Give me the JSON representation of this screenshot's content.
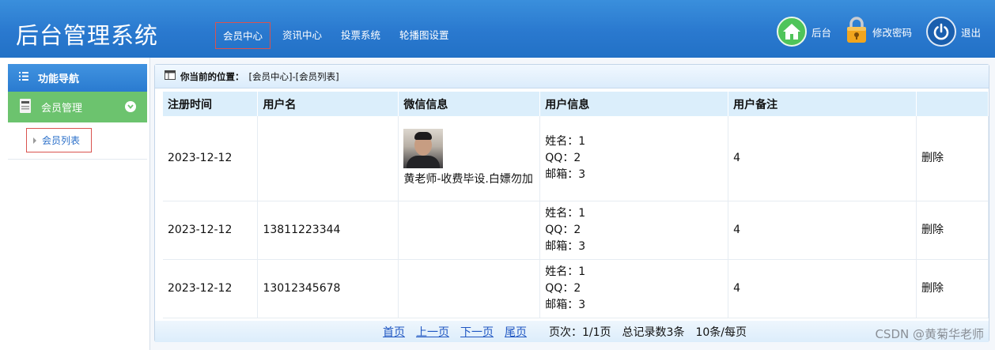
{
  "header": {
    "title": "后台管理系统",
    "nav": [
      {
        "label": "会员中心"
      },
      {
        "label": "资讯中心"
      },
      {
        "label": "投票系统"
      },
      {
        "label": "轮播图设置"
      }
    ],
    "tools": {
      "home_label": "后台",
      "password_label": "修改密码",
      "logout_label": "退出"
    }
  },
  "sidebar": {
    "title": "功能导航",
    "group_label": "会员管理",
    "sub_item": "会员列表"
  },
  "breadcrumb": {
    "label": "你当前的位置：",
    "path": "[会员中心]-[会员列表]"
  },
  "table": {
    "headers": [
      "注册时间",
      "用户名",
      "微信信息",
      "用户信息",
      "用户备注",
      ""
    ],
    "rows": [
      {
        "date": "2023-12-12",
        "username": "",
        "wechat": "黄老师-收费毕设.白嫖勿加",
        "name": "姓名：1",
        "qq": "QQ：2",
        "email": "邮箱：3",
        "note": "4",
        "action": "删除"
      },
      {
        "date": "2023-12-12",
        "username": "13811223344",
        "wechat": "",
        "name": "姓名：1",
        "qq": "QQ：2",
        "email": "邮箱：3",
        "note": "4",
        "action": "删除"
      },
      {
        "date": "2023-12-12",
        "username": "13012345678",
        "wechat": "",
        "name": "姓名：1",
        "qq": "QQ：2",
        "email": "邮箱：3",
        "note": "4",
        "action": "删除"
      }
    ]
  },
  "pager": {
    "first": "首页",
    "prev": "上一页",
    "next": "下一页",
    "last": "尾页",
    "page_info": "页次：1/1页",
    "total": "总记录数3条",
    "per_page": "10条/每页"
  },
  "watermark": "CSDN @黄菊华老师",
  "colors": {
    "header_blue": "#2a79cf",
    "sidebar_green": "#6cc36e",
    "highlight_border": "#d9534f",
    "link_blue": "#1f56c2"
  }
}
